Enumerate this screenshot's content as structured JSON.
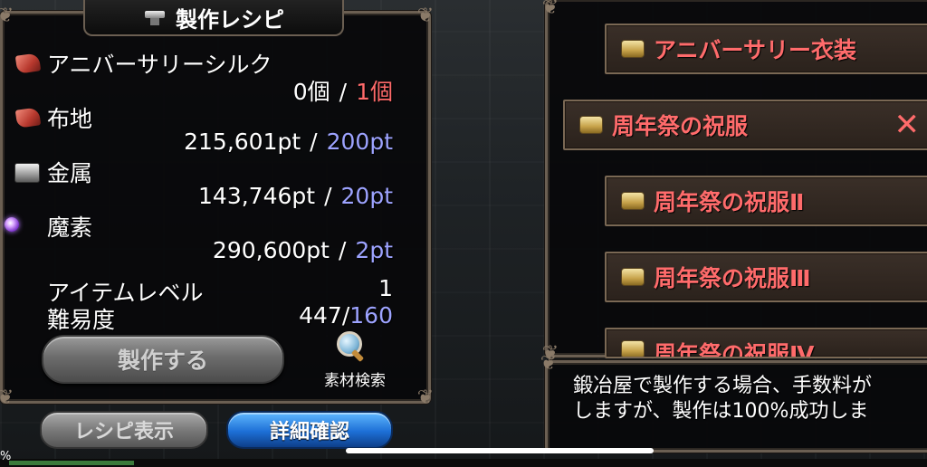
{
  "recipe_panel": {
    "title": "製作レシピ",
    "materials": [
      {
        "name": "アニバーサリーシルク",
        "have": "0個",
        "need": "1個",
        "need_color": "red",
        "icon": "cloth-icon"
      },
      {
        "name": "布地",
        "have": "215,601pt",
        "need": "200pt",
        "need_color": "blue",
        "icon": "cloth-icon"
      },
      {
        "name": "金属",
        "have": "143,746pt",
        "need": "20pt",
        "need_color": "blue",
        "icon": "metal-icon"
      },
      {
        "name": "魔素",
        "have": "290,600pt",
        "need": "2pt",
        "need_color": "blue",
        "icon": "essence-icon"
      }
    ],
    "separator": "/",
    "item_level_label": "アイテムレベル",
    "item_level_value": "1",
    "difficulty_label": "難易度",
    "difficulty_current": "447",
    "difficulty_slash": "/",
    "difficulty_max": "160",
    "craft_button": "製作する",
    "search_label": "素材検索"
  },
  "bottom_tabs": {
    "recipe_view": "レシピ表示",
    "detail_check": "詳細確認"
  },
  "recipe_list": [
    {
      "label": "アニバーサリー衣装",
      "selected": false
    },
    {
      "label": "周年祭の祝服",
      "selected": true
    },
    {
      "label": "周年祭の祝服Ⅱ",
      "selected": false
    },
    {
      "label": "周年祭の祝服Ⅲ",
      "selected": false
    },
    {
      "label": "周年祭の祝服Ⅳ",
      "selected": false
    }
  ],
  "message": {
    "line1": "鍛冶屋で製作する場合、手数料が",
    "line2": "しますが、製作は100%成功しま"
  },
  "status_percent": "%",
  "colors": {
    "need_red": "#ff6a6a",
    "need_blue": "#9da3ff",
    "list_label": "#ff6b6b",
    "detail_button": "#1d6fd6"
  }
}
